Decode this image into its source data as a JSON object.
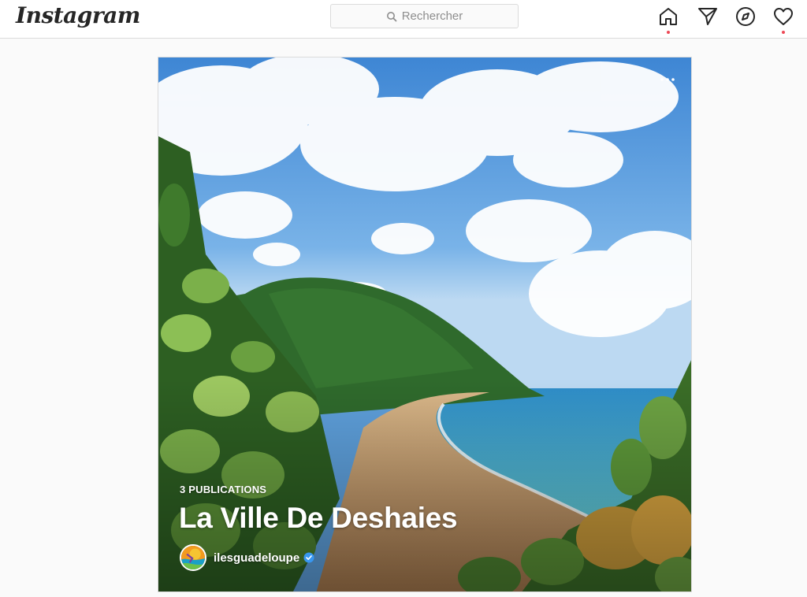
{
  "nav": {
    "logo": "Instagram",
    "search_placeholder": "Rechercher",
    "icons": [
      "home-icon",
      "direct-message-icon",
      "explore-icon",
      "activity-heart-icon"
    ],
    "notification_dot_color": "#ed4956"
  },
  "guide": {
    "publication_count": "3 PUBLICATIONS",
    "title": "La Ville De Deshaies",
    "author": "ilesguadeloupe",
    "verified": true,
    "image": "beach-hillside-photo"
  },
  "colors": {
    "border": "#dbdbdb",
    "background": "#fafafa",
    "verified_badge": "#3897f0"
  }
}
